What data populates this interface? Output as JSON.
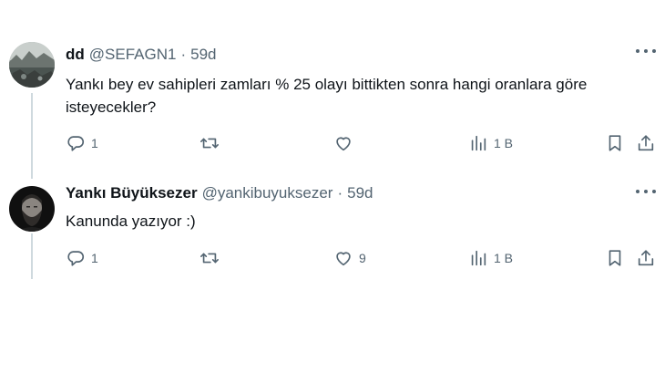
{
  "tweets": [
    {
      "name": "dd",
      "handle": "@SEFAGN1",
      "separator": "·",
      "time": "59d",
      "text": "Yankı bey ev sahipleri zamları % 25 olayı bittikten sonra hangi oranlara göre isteyecekler?",
      "replies": "1",
      "reposts": "",
      "likes": "",
      "views": "1 B",
      "avatar_icon": "landscape-photo"
    },
    {
      "name": "Yankı Büyüksezer",
      "handle": "@yankibuyuksezer",
      "separator": "·",
      "time": "59d",
      "text": "Kanunda yazıyor :)",
      "replies": "1",
      "reposts": "",
      "likes": "9",
      "views": "1 B",
      "avatar_icon": "bearded-man-photo"
    }
  ],
  "icons": {
    "reply": "reply-icon",
    "repost": "repost-icon",
    "like": "heart-icon",
    "views": "analytics-icon",
    "bookmark": "bookmark-icon",
    "share": "share-icon",
    "more": "more-icon"
  },
  "colors": {
    "text": "#0f1419",
    "secondary": "#536471",
    "thread_line": "#cfd9de",
    "background": "#ffffff"
  }
}
